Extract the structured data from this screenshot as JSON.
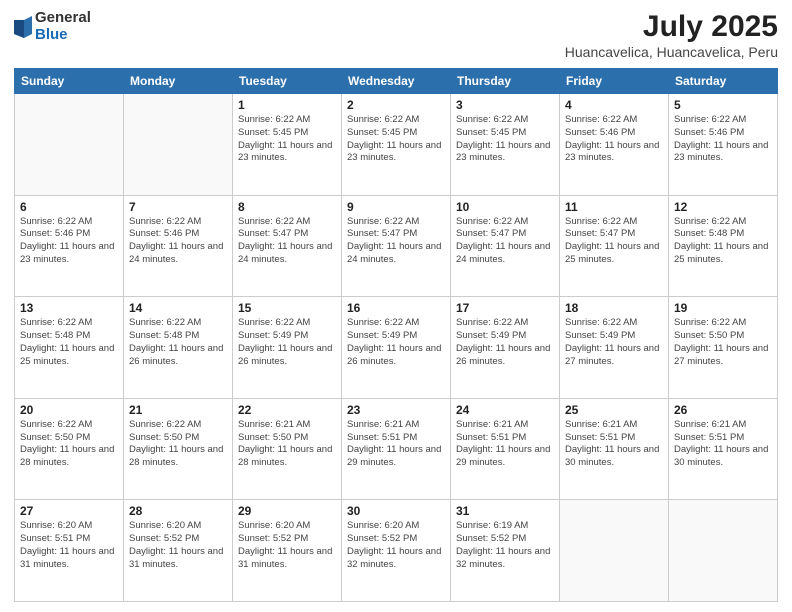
{
  "logo": {
    "general": "General",
    "blue": "Blue"
  },
  "title": "July 2025",
  "subtitle": "Huancavelica, Huancavelica, Peru",
  "header_days": [
    "Sunday",
    "Monday",
    "Tuesday",
    "Wednesday",
    "Thursday",
    "Friday",
    "Saturday"
  ],
  "weeks": [
    [
      {
        "day": "",
        "info": ""
      },
      {
        "day": "",
        "info": ""
      },
      {
        "day": "1",
        "info": "Sunrise: 6:22 AM\nSunset: 5:45 PM\nDaylight: 11 hours and 23 minutes."
      },
      {
        "day": "2",
        "info": "Sunrise: 6:22 AM\nSunset: 5:45 PM\nDaylight: 11 hours and 23 minutes."
      },
      {
        "day": "3",
        "info": "Sunrise: 6:22 AM\nSunset: 5:45 PM\nDaylight: 11 hours and 23 minutes."
      },
      {
        "day": "4",
        "info": "Sunrise: 6:22 AM\nSunset: 5:46 PM\nDaylight: 11 hours and 23 minutes."
      },
      {
        "day": "5",
        "info": "Sunrise: 6:22 AM\nSunset: 5:46 PM\nDaylight: 11 hours and 23 minutes."
      }
    ],
    [
      {
        "day": "6",
        "info": "Sunrise: 6:22 AM\nSunset: 5:46 PM\nDaylight: 11 hours and 23 minutes."
      },
      {
        "day": "7",
        "info": "Sunrise: 6:22 AM\nSunset: 5:46 PM\nDaylight: 11 hours and 24 minutes."
      },
      {
        "day": "8",
        "info": "Sunrise: 6:22 AM\nSunset: 5:47 PM\nDaylight: 11 hours and 24 minutes."
      },
      {
        "day": "9",
        "info": "Sunrise: 6:22 AM\nSunset: 5:47 PM\nDaylight: 11 hours and 24 minutes."
      },
      {
        "day": "10",
        "info": "Sunrise: 6:22 AM\nSunset: 5:47 PM\nDaylight: 11 hours and 24 minutes."
      },
      {
        "day": "11",
        "info": "Sunrise: 6:22 AM\nSunset: 5:47 PM\nDaylight: 11 hours and 25 minutes."
      },
      {
        "day": "12",
        "info": "Sunrise: 6:22 AM\nSunset: 5:48 PM\nDaylight: 11 hours and 25 minutes."
      }
    ],
    [
      {
        "day": "13",
        "info": "Sunrise: 6:22 AM\nSunset: 5:48 PM\nDaylight: 11 hours and 25 minutes."
      },
      {
        "day": "14",
        "info": "Sunrise: 6:22 AM\nSunset: 5:48 PM\nDaylight: 11 hours and 26 minutes."
      },
      {
        "day": "15",
        "info": "Sunrise: 6:22 AM\nSunset: 5:49 PM\nDaylight: 11 hours and 26 minutes."
      },
      {
        "day": "16",
        "info": "Sunrise: 6:22 AM\nSunset: 5:49 PM\nDaylight: 11 hours and 26 minutes."
      },
      {
        "day": "17",
        "info": "Sunrise: 6:22 AM\nSunset: 5:49 PM\nDaylight: 11 hours and 26 minutes."
      },
      {
        "day": "18",
        "info": "Sunrise: 6:22 AM\nSunset: 5:49 PM\nDaylight: 11 hours and 27 minutes."
      },
      {
        "day": "19",
        "info": "Sunrise: 6:22 AM\nSunset: 5:50 PM\nDaylight: 11 hours and 27 minutes."
      }
    ],
    [
      {
        "day": "20",
        "info": "Sunrise: 6:22 AM\nSunset: 5:50 PM\nDaylight: 11 hours and 28 minutes."
      },
      {
        "day": "21",
        "info": "Sunrise: 6:22 AM\nSunset: 5:50 PM\nDaylight: 11 hours and 28 minutes."
      },
      {
        "day": "22",
        "info": "Sunrise: 6:21 AM\nSunset: 5:50 PM\nDaylight: 11 hours and 28 minutes."
      },
      {
        "day": "23",
        "info": "Sunrise: 6:21 AM\nSunset: 5:51 PM\nDaylight: 11 hours and 29 minutes."
      },
      {
        "day": "24",
        "info": "Sunrise: 6:21 AM\nSunset: 5:51 PM\nDaylight: 11 hours and 29 minutes."
      },
      {
        "day": "25",
        "info": "Sunrise: 6:21 AM\nSunset: 5:51 PM\nDaylight: 11 hours and 30 minutes."
      },
      {
        "day": "26",
        "info": "Sunrise: 6:21 AM\nSunset: 5:51 PM\nDaylight: 11 hours and 30 minutes."
      }
    ],
    [
      {
        "day": "27",
        "info": "Sunrise: 6:20 AM\nSunset: 5:51 PM\nDaylight: 11 hours and 31 minutes."
      },
      {
        "day": "28",
        "info": "Sunrise: 6:20 AM\nSunset: 5:52 PM\nDaylight: 11 hours and 31 minutes."
      },
      {
        "day": "29",
        "info": "Sunrise: 6:20 AM\nSunset: 5:52 PM\nDaylight: 11 hours and 31 minutes."
      },
      {
        "day": "30",
        "info": "Sunrise: 6:20 AM\nSunset: 5:52 PM\nDaylight: 11 hours and 32 minutes."
      },
      {
        "day": "31",
        "info": "Sunrise: 6:19 AM\nSunset: 5:52 PM\nDaylight: 11 hours and 32 minutes."
      },
      {
        "day": "",
        "info": ""
      },
      {
        "day": "",
        "info": ""
      }
    ]
  ]
}
